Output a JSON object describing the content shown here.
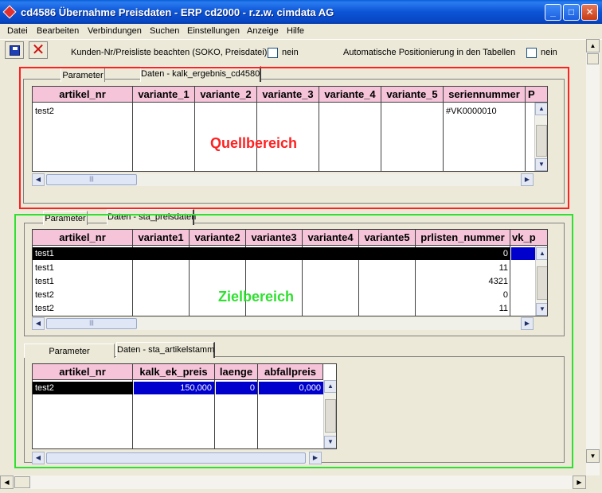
{
  "window": {
    "title": "cd4586 Übernahme Preisdaten - ERP cd2000 - r.z.w. cimdata AG",
    "min": "_",
    "max": "□",
    "close": "✕"
  },
  "menu": [
    "Datei",
    "Bearbeiten",
    "Verbindungen",
    "Suchen",
    "Einstellungen",
    "Anzeige",
    "Hilfe"
  ],
  "toolbar": {
    "option1_label": "Kunden-Nr/Preisliste beachten  (SOKO, Preisdatei)",
    "option1_value": "nein",
    "option2_label": "Automatische Positionierung in den Tabellen",
    "option2_value": "nein"
  },
  "source": {
    "overlay_label": "Quellbereich",
    "tabs": [
      "Parameter",
      "Daten - kalk_ergebnis_cd4580"
    ],
    "columns": [
      "artikel_nr",
      "variante_1",
      "variante_2",
      "variante_3",
      "variante_4",
      "variante_5",
      "seriennummer",
      "P"
    ],
    "rows": [
      [
        "test2",
        "",
        "",
        "",
        "",
        "",
        "#VK0000010",
        ""
      ]
    ]
  },
  "target": {
    "overlay_label": "Zielbereich",
    "tabs": [
      "Parameter",
      "Daten - sta_preisdaten"
    ],
    "columns": [
      "artikel_nr",
      "variante1",
      "variante2",
      "variante3",
      "variante4",
      "variante5",
      "prlisten_nummer",
      "vk_p"
    ],
    "rows": [
      [
        "test1",
        "",
        "",
        "",
        "",
        "",
        "0",
        ""
      ],
      [
        "test1",
        "",
        "",
        "",
        "",
        "",
        "11",
        ""
      ],
      [
        "test1",
        "",
        "",
        "",
        "",
        "",
        "4321",
        ""
      ],
      [
        "test2",
        "",
        "",
        "",
        "",
        "",
        "0",
        ""
      ],
      [
        "test2",
        "",
        "",
        "",
        "",
        "",
        "11",
        ""
      ]
    ]
  },
  "articles": {
    "tabs": [
      "Parameter",
      "Daten - sta_artikelstamm"
    ],
    "columns": [
      "artikel_nr",
      "kalk_ek_preis",
      "laenge",
      "abfallpreis"
    ],
    "rows": [
      [
        "test2",
        "150,000",
        "0",
        "0,000"
      ]
    ]
  },
  "scroll": {
    "left": "◀",
    "right": "▶",
    "up": "▲",
    "down": "▼",
    "grip": "|||"
  }
}
